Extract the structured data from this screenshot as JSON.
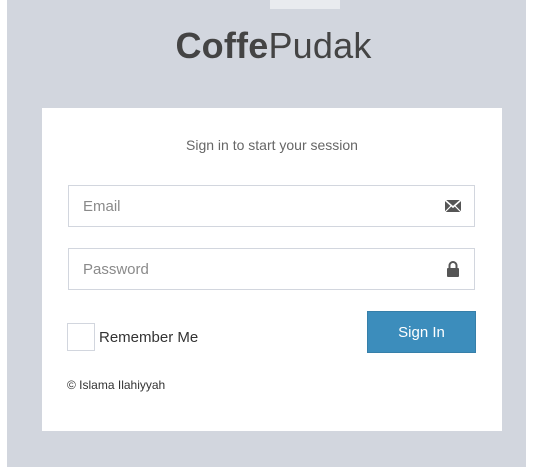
{
  "logo": {
    "bold": "Coffe",
    "light": "Pudak"
  },
  "login": {
    "message": "Sign in to start your session",
    "email": {
      "placeholder": "Email",
      "value": "",
      "icon": "envelope-icon"
    },
    "password": {
      "placeholder": "Password",
      "value": "",
      "icon": "lock-icon"
    },
    "remember_label": "Remember Me",
    "remember_checked": false,
    "signin_label": "Sign In",
    "footer": "© Islama Ilahiyyah"
  },
  "colors": {
    "page_background": "#d2d6de",
    "box_background": "#ffffff",
    "primary_button": "#3c8dbc",
    "field_border": "#d2d6de",
    "logo_text": "#444444"
  }
}
